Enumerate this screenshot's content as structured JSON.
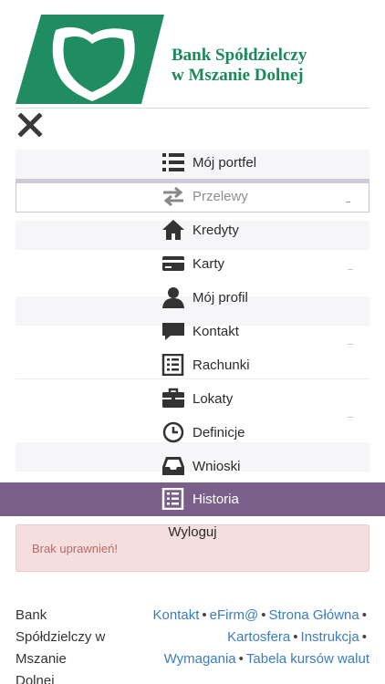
{
  "header": {
    "bank_name_line1": "Bank Spółdzielczy",
    "bank_name_line2": "w Mszanie Dolnej",
    "brand_color": "#1a8a5a",
    "logo_icon": "bank-shield-logo"
  },
  "close_icon": "close-icon",
  "menu": {
    "items": [
      {
        "label": "Mój portfel",
        "icon": "list-icon"
      },
      {
        "label": "Przelewy",
        "icon": "transfer-arrows-icon"
      },
      {
        "label": "Kredyty",
        "icon": "home-icon"
      },
      {
        "label": "Karty",
        "icon": "credit-card-icon"
      },
      {
        "label": "Mój profil",
        "icon": "user-icon"
      },
      {
        "label": "Kontakt",
        "icon": "chat-icon"
      },
      {
        "label": "Rachunki",
        "icon": "document-list-icon"
      },
      {
        "label": "Lokaty",
        "icon": "briefcase-icon"
      },
      {
        "label": "Definicje",
        "icon": "clock-icon"
      },
      {
        "label": "Wnioski",
        "icon": "inbox-icon"
      },
      {
        "label": "Historia",
        "icon": "document-list-icon"
      }
    ],
    "active_label": "Historia",
    "active_color": "#7a5f8b",
    "logout_label": "Wyloguj"
  },
  "alert": {
    "text": "Brak uprawnień!"
  },
  "footer": {
    "left_lines": [
      "Bank",
      "Spółdzielczy w",
      "Mszanie",
      "Dolnej"
    ],
    "links": {
      "kontakt": "Kontakt",
      "efirma": "eFirm@",
      "strona": "Strona Główna",
      "kartosfera": "Kartosfera",
      "instrukcja": "Instrukcja",
      "wymagania": "Wymagania",
      "tabela": "Tabela kursów walut"
    },
    "separator": "•",
    "link_color": "#3a7cc0"
  }
}
